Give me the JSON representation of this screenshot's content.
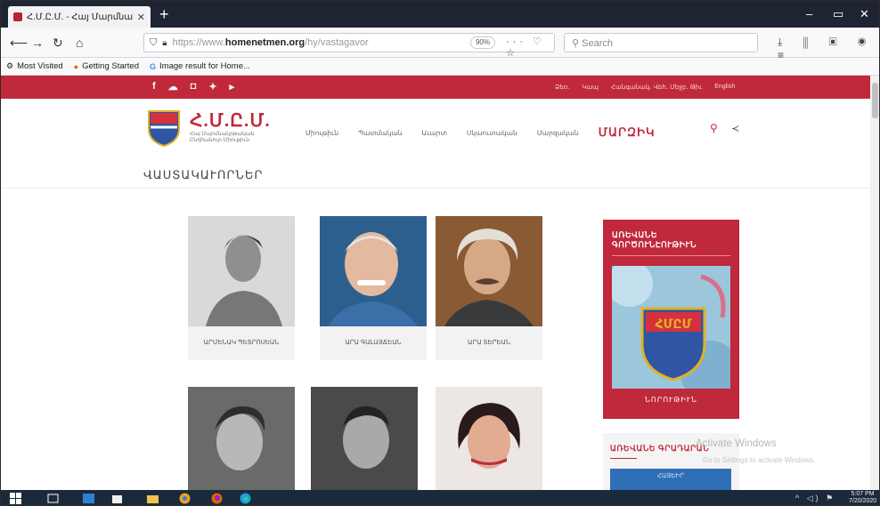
{
  "browser": {
    "tab_title": "Հ.Մ.Ը.Մ. - Հայ Մարմնակրթ...",
    "tab_close": "✕",
    "new_tab": "+",
    "url_prefix": "https://www.",
    "url_domain": "homenetmen.org",
    "url_path": "/hy/vastagavor",
    "zoom": "90%",
    "search_placeholder": "Search",
    "bookmarks": [
      {
        "label": "Most Visited",
        "icon": "gear-icon"
      },
      {
        "label": "Getting Started",
        "icon": "firefox-icon"
      },
      {
        "label": "Image result for Home...",
        "icon": "google-icon"
      }
    ]
  },
  "site": {
    "social_icons": [
      "facebook-icon",
      "cloud-icon",
      "instagram-icon",
      "twitter-icon",
      "youtube-icon"
    ],
    "top_links": [
      "Ձեռ.",
      "Կապ",
      "Հանգանակ․ Վեհ․ Մեջբ․ Թիւ",
      "English"
    ],
    "brand_name": "Հ.Մ.Ը.Մ.",
    "brand_line1": "Հայ Մարմնակրթական",
    "brand_line2": "Ընդհանուր Միութիւն",
    "nav": [
      "Միութիւն",
      "Պատմական",
      "Աւարտ",
      "Սկաուտական",
      "Մարզական"
    ],
    "nav_highlight": "ՄԱՐԶԻԿ",
    "page_title": "ՎԱՍՏԱԿԱՒՈՐՆԵՐ",
    "cards": [
      {
        "name": "ԱՐՄԵՆԱԿ ՊԵՏՐՈՍԵԱՆ"
      },
      {
        "name": "ԱՐԱ ԳԱԼԱՅՃԵԱՆ"
      },
      {
        "name": "ԱՐԱ ՏԵՐԵԱՆ"
      },
      {
        "name": ""
      },
      {
        "name": ""
      },
      {
        "name": ""
      }
    ],
    "sidebar1": {
      "title_line1": "ԱՌԵՎԱՆԵ",
      "title_line2": "ԳՈՐԾՈՒՆԷՈՒԹԻՒՆ",
      "button": "ՆՈՐՈՒԹԻՒՆ"
    },
    "sidebar2": {
      "title": "ԱՌԵՎԱՆԵ ԳՐԱԴԱՐԱՆ",
      "box_text": "ՀԱՅԵԻՐ"
    },
    "watermark_title": "Activate Windows",
    "watermark_sub": "Go to Settings to activate Windows."
  },
  "taskbar": {
    "time": "5:07 PM",
    "date": "7/20/2020"
  },
  "colors": {
    "brand_red": "#c0283b",
    "tabbar": "#1f2433",
    "taskbar": "#1b2a3b"
  }
}
